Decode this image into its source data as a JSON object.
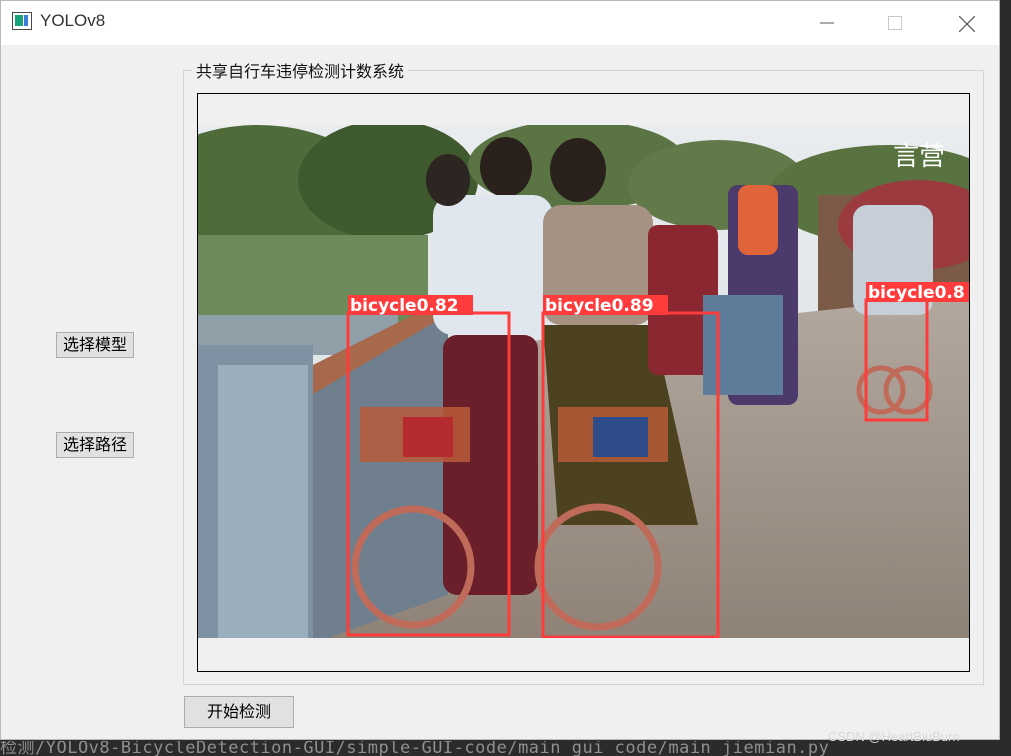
{
  "window": {
    "title": "YOLOv8",
    "controls": {
      "minimize": "minimize-icon",
      "maximize": "maximize-icon",
      "close": "close-icon"
    }
  },
  "group": {
    "title": "共享自行车违停检测计数系统"
  },
  "buttons": {
    "select_model": "选择模型",
    "select_path": "选择路径",
    "start_detection": "开始检测"
  },
  "detections": [
    {
      "label": "bicycle0.82"
    },
    {
      "label": "bicycle0.89"
    },
    {
      "label": "bicycle0.8"
    }
  ],
  "photo_logo": "言营",
  "terminal": {
    "text": "检测/YOLOv8-BicycleDetection-GUI/simple-GUI-code/main_gui_code/main_jiemian.py"
  },
  "watermark": "CSDN @HeartBiuBurn",
  "colors": {
    "detection_box": "#ff3b3b",
    "window_bg": "#f0f0f0",
    "titlebar_bg": "#ffffff"
  }
}
